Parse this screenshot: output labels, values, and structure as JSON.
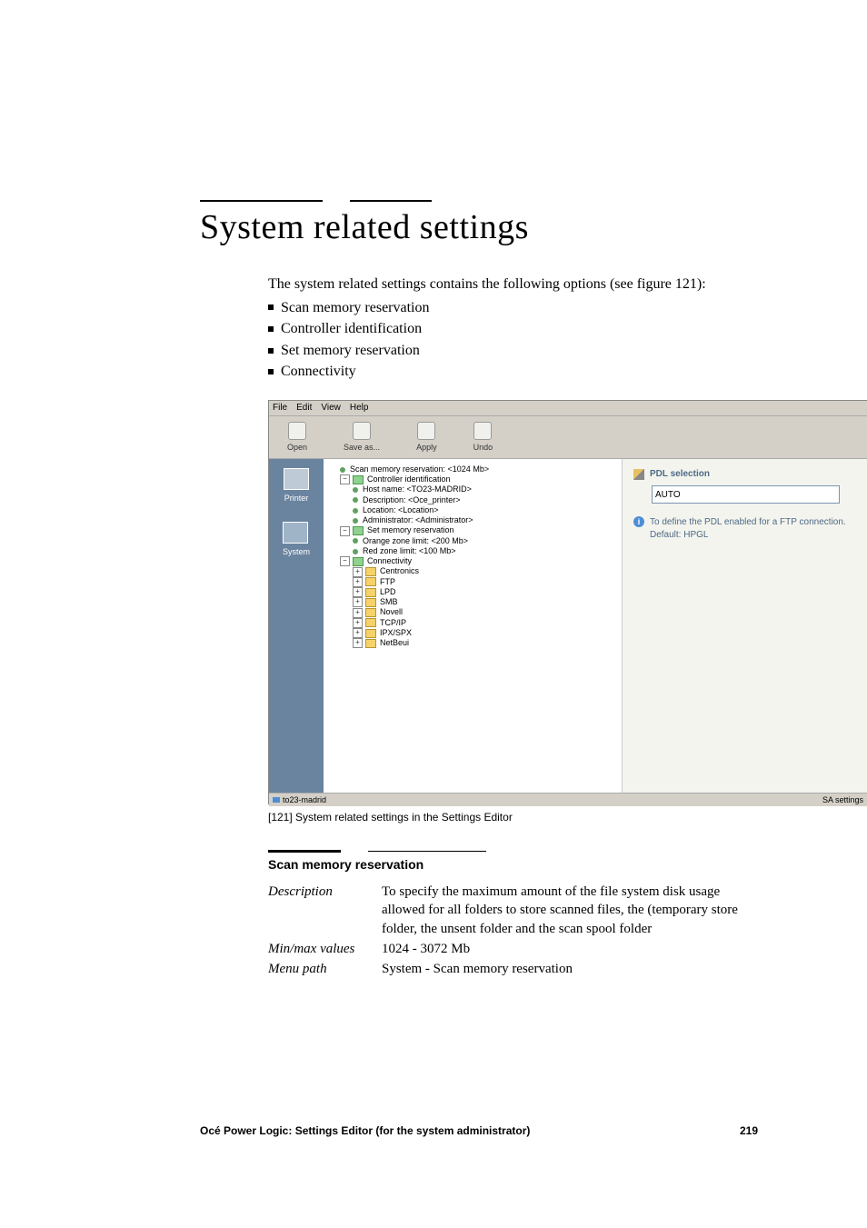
{
  "title": "System related settings",
  "intro": "The system related settings contains the following options (see figure 121):",
  "bullets": [
    "Scan memory reservation",
    "Controller identification",
    "Set memory reservation",
    "Connectivity"
  ],
  "screenshot": {
    "menubar": {
      "file": "File",
      "edit": "Edit",
      "view": "View",
      "help": "Help"
    },
    "toolbar": {
      "open": "Open",
      "saveas": "Save as...",
      "apply": "Apply",
      "undo": "Undo"
    },
    "leftbar": {
      "printer": "Printer",
      "system": "System"
    },
    "tree": {
      "scan_mem": "Scan memory reservation: <1024 Mb>",
      "controller_id": "Controller identification",
      "host": "Host name: <TO23-MADRID>",
      "desc": "Description: <Oce_printer>",
      "loc": "Location: <Location>",
      "admin": "Administrator: <Administrator>",
      "set_mem": "Set memory reservation",
      "orange": "Orange zone limit: <200 Mb>",
      "red": "Red zone limit: <100 Mb>",
      "connectivity": "Connectivity",
      "centronics": "Centronics",
      "ftp": "FTP",
      "lpd": "LPD",
      "smb": "SMB",
      "novell": "Novell",
      "tcpip": "TCP/IP",
      "ipxspx": "IPX/SPX",
      "netbeui": "NetBeui"
    },
    "rightpanel": {
      "heading": "PDL selection",
      "field_value": "AUTO",
      "info_line1": "To define the PDL enabled for a FTP connection.",
      "info_line2": "Default: HPGL"
    },
    "statusbar": {
      "left": "to23-madrid",
      "right": "SA settings"
    }
  },
  "caption": "[121] System related settings in the Settings Editor",
  "section_heading": "Scan memory reservation",
  "spec": {
    "description_label": "Description",
    "description_value": "To specify the maximum amount of the file system disk usage allowed for all folders to store scanned files, the (temporary store folder, the unsent folder and the scan spool folder",
    "minmax_label": "Min/max values",
    "minmax_value": "1024 - 3072 Mb",
    "menupath_label": "Menu path",
    "menupath_value": "System - Scan memory reservation"
  },
  "footer": {
    "left": "Océ Power Logic: Settings Editor (for the system administrator)",
    "right": "219"
  }
}
